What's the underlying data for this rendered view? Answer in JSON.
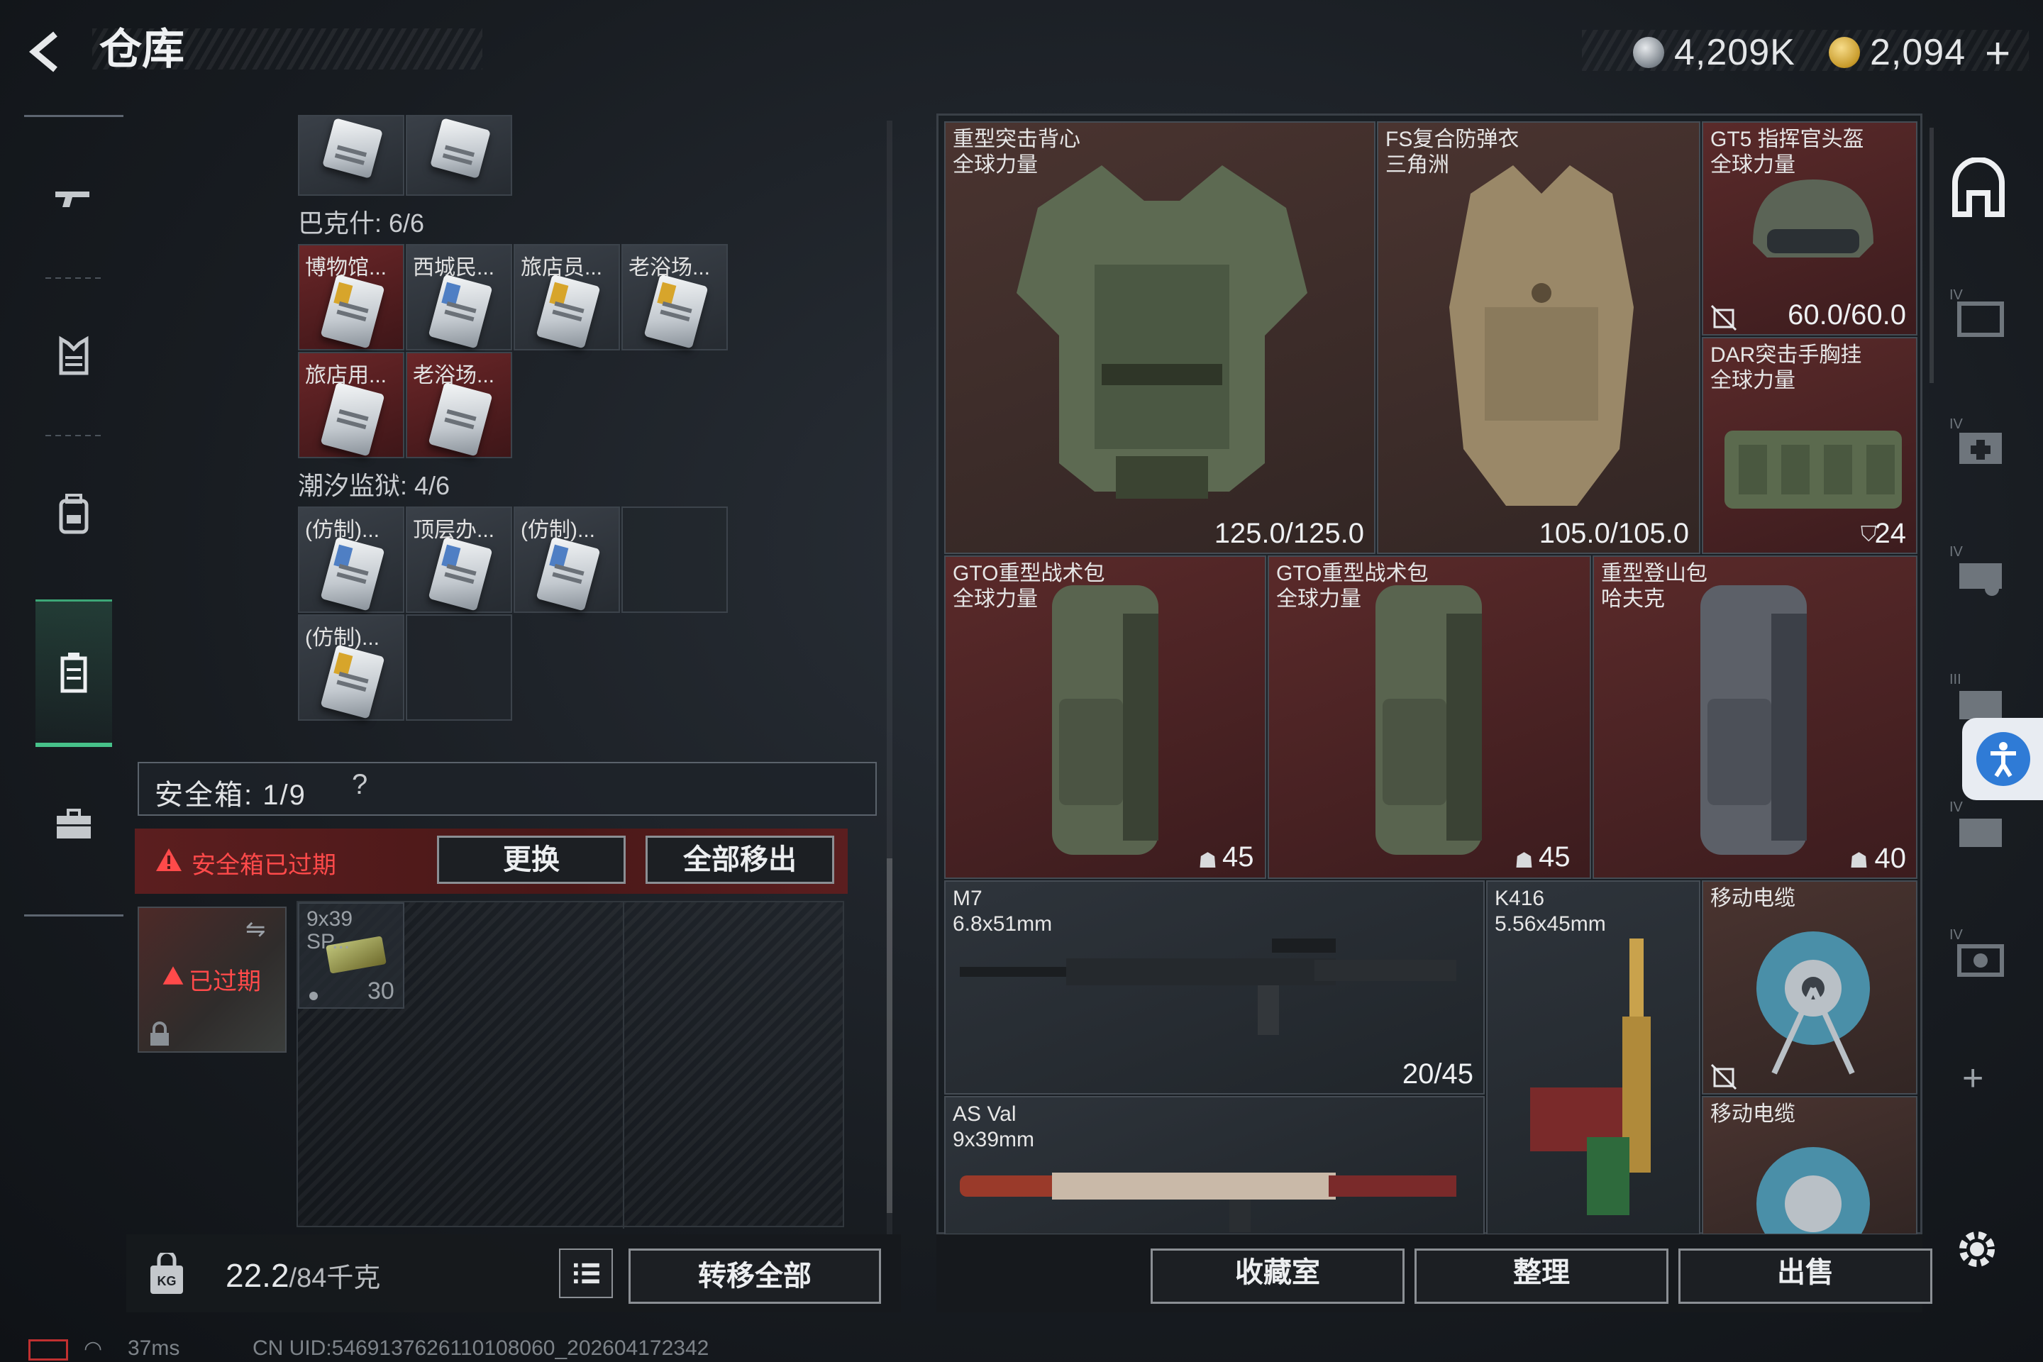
{
  "header": {
    "title": "仓库",
    "currency1": "4,209K",
    "currency2": "2,094",
    "plus": "+"
  },
  "nav": {
    "items": [
      "gun-icon",
      "vest-icon",
      "backpack-icon",
      "locker-icon",
      "briefcase-icon"
    ],
    "active": "locker-icon"
  },
  "groups": {
    "bakesh": "巴克什: 6/6",
    "chaoxi": "潮汐监狱: 4/6"
  },
  "bakesh_cells": [
    "博物馆...",
    "西城民...",
    "旅店员...",
    "老浴场...",
    "旅店用...",
    "老浴场..."
  ],
  "chaoxi_cells": [
    "(仿制)...",
    "顶层办...",
    "(仿制)...",
    "(仿制)..."
  ],
  "safe_box": {
    "label": "安全箱: 1/9",
    "help": "?",
    "expired_notice": "安全箱已过期",
    "replace_btn": "更换",
    "remove_all_btn": "全部移出",
    "thumb_expired": "已过期",
    "ammo_label": "9x39\nSP...",
    "ammo_count": "30"
  },
  "weight": {
    "current": "22.2",
    "max": "/84千克"
  },
  "transfer_all_btn": "转移全部",
  "items": {
    "heavy_vest": {
      "name": "重型突击背心\n全球力量",
      "value": "125.0/125.0"
    },
    "fs_armor": {
      "name": "FS复合防弹衣\n三角洲",
      "value": "105.0/105.0"
    },
    "gt5_helmet": {
      "name": "GT5 指挥官头盔\n全球力量",
      "value": "60.0/60.0"
    },
    "dar_rig": {
      "name": "DAR突击手胸挂\n全球力量",
      "value": "24"
    },
    "gto_bag1": {
      "name": "GTO重型战术包\n全球力量",
      "value": "45"
    },
    "gto_bag2": {
      "name": "GTO重型战术包\n全球力量",
      "value": "45"
    },
    "heavy_climb": {
      "name": "重型登山包\n哈夫克",
      "value": "40"
    },
    "m7": {
      "name": "M7\n6.8x51mm",
      "value": "20/45"
    },
    "k416": {
      "name": "K416\n5.56x45mm"
    },
    "cable1": {
      "name": "移动电缆"
    },
    "asval": {
      "name": "AS Val\n9x39mm"
    },
    "cable2": {
      "name": "移动电缆"
    }
  },
  "actions": {
    "collection": "收藏室",
    "sort": "整理",
    "sell": "出售"
  },
  "side_tools": [
    "home-icon",
    "tier4-folder-icon",
    "tier4-medkit-icon",
    "tier4-ammo-icon",
    "tier3-case-icon",
    "tier4-case-plus-icon",
    "tier4-camera-icon"
  ],
  "side_plus": "+",
  "status": {
    "ping": "37ms",
    "uid": "CN UID:5469137626110108060_202604172342"
  },
  "colors": {
    "accent_green": "#47c28a",
    "warning_red": "#ff4a4a",
    "cell_red": "#5a2a2a"
  }
}
